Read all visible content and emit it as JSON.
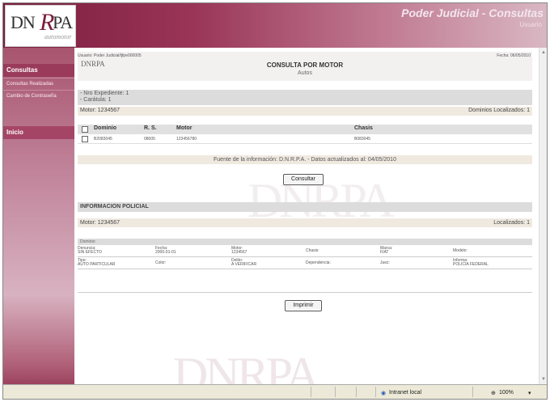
{
  "banner": {
    "logo_text": "DN",
    "logo_r": "R",
    "logo_pa": "PA",
    "logo_sub": "automotor",
    "title": "Poder Judicial - Consultas",
    "subtitle": "Usuario"
  },
  "sidebar": {
    "items": [
      {
        "label": "Consultas"
      },
      {
        "label": "Consultas Realizadas"
      },
      {
        "label": "Cambio de Contraseña"
      },
      {
        "label": "Inicio"
      }
    ]
  },
  "header": {
    "user": "Usuario: Poder Judicial/ljfpe000005",
    "fecha": "Fecha: 06/05/2010",
    "logo": "DNRPA",
    "title": "CONSULTA POR MOTOR",
    "subtitle": "Autos"
  },
  "expediente": {
    "line1": "- Nro Expediente: 1",
    "line2": "- Carátula: 1"
  },
  "motor_bar": {
    "left": "Motor: 1234567",
    "right": "Dominios Localizados: 1"
  },
  "table": {
    "headers": [
      "Dominio",
      "R. S.",
      "Motor",
      "Chasis"
    ],
    "rows": [
      {
        "dominio": "B2083045",
        "rs": "08005",
        "motor": "123456780",
        "chasis": "B083045"
      }
    ]
  },
  "fuente": "Fuente de la información: D.N.R.P.A. - Datos actualizados al: 04/05/2010",
  "buttons": {
    "consultar": "Consultar",
    "imprimir": "Imprimir"
  },
  "policial": {
    "title": "INFORMACION POLICIAL",
    "motor_left": "Motor: 1234567",
    "motor_right": "Localizados: 1",
    "dominio_label": "Dominio:",
    "row1": [
      {
        "label": "Denuncia:",
        "value": "SIN EFECTO"
      },
      {
        "label": "Fecha:",
        "value": "2000-01-01"
      },
      {
        "label": "Motor:",
        "value": "1234567"
      },
      {
        "label": "Chasis:",
        "value": ""
      },
      {
        "label": "Marca:",
        "value": "FIAT"
      },
      {
        "label": "Modelo:",
        "value": ""
      }
    ],
    "row2": [
      {
        "label": "Tipo:",
        "value": "AUTO PARTICULAR"
      },
      {
        "label": "Color:",
        "value": ""
      },
      {
        "label": "Delito:",
        "value": "A VERIFICAR"
      },
      {
        "label": "Dependencia:",
        "value": ""
      },
      {
        "label": "Juez:",
        "value": ""
      },
      {
        "label": "Informa:",
        "value": "POLICIA FEDERAL"
      }
    ]
  },
  "statusbar": {
    "zone": "Intranet local",
    "zoom": "100%"
  }
}
